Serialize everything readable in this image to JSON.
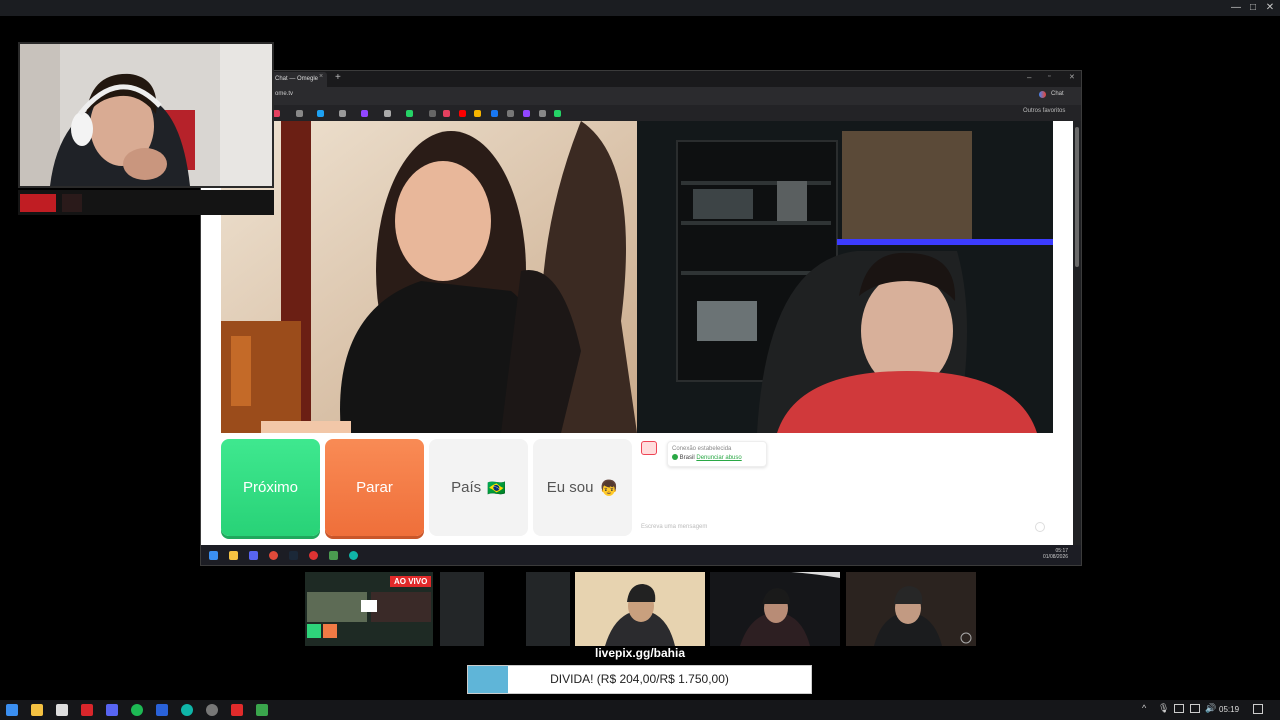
{
  "browser": {
    "tab_title": "Chat — Omegle",
    "url": "ome.tv",
    "chat_toolbar_label": "Chat",
    "bookmarks_folder": "Outros favoritos"
  },
  "buttons": {
    "next": "Próximo",
    "stop": "Parar",
    "country": "País",
    "country_flag": "🇧🇷",
    "iam": "Eu sou",
    "iam_emoji": "👦"
  },
  "chat": {
    "status": "Conexão estabelecida",
    "country": "Brasil",
    "report": "Denunciar abuso",
    "input_placeholder": "Escreva uma mensagem"
  },
  "inner_taskbar": {
    "time": "05:17",
    "date": "01/08/2026"
  },
  "stream": {
    "live_badge": "AO VIVO",
    "donation_link": "livepix.gg/bahia",
    "goal_text": "DIVIDA! (R$ 204,00/R$ 1.750,00)",
    "goal_progress": 0.117
  },
  "taskbar": {
    "clock": "05:19"
  },
  "colors": {
    "next_green": "#2ed47a",
    "stop_orange": "#f17a45",
    "goal_fill": "#5fb5d8",
    "live_red": "#e12a2a"
  }
}
